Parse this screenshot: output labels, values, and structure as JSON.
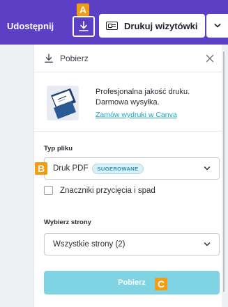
{
  "toolbar": {
    "share_label": "Udostępnij",
    "print_label": "Drukuj wizytówki"
  },
  "badges": {
    "a": "A",
    "b": "B",
    "c": "C"
  },
  "panel": {
    "title": "Pobierz",
    "promo": {
      "line1": "Profesjonalna jakość druku.",
      "line2": "Darmowa wysyłka.",
      "link": "Zamów wydruki w Canva"
    },
    "file_type": {
      "label": "Typ pliku",
      "value": "Druk PDF",
      "tag": "SUGEROWANE"
    },
    "crop_marks": {
      "label": "Znaczniki przycięcia i spad",
      "checked": false
    },
    "pages": {
      "label": "Wybierz strony",
      "value": "Wszystkie strony (2)"
    },
    "download_label": "Pobierz"
  },
  "colors": {
    "toolbar_bg": "#5b3fc4",
    "badge": "#f39c12",
    "download_button": "#7fd3e3",
    "link": "#1fa6c9"
  }
}
